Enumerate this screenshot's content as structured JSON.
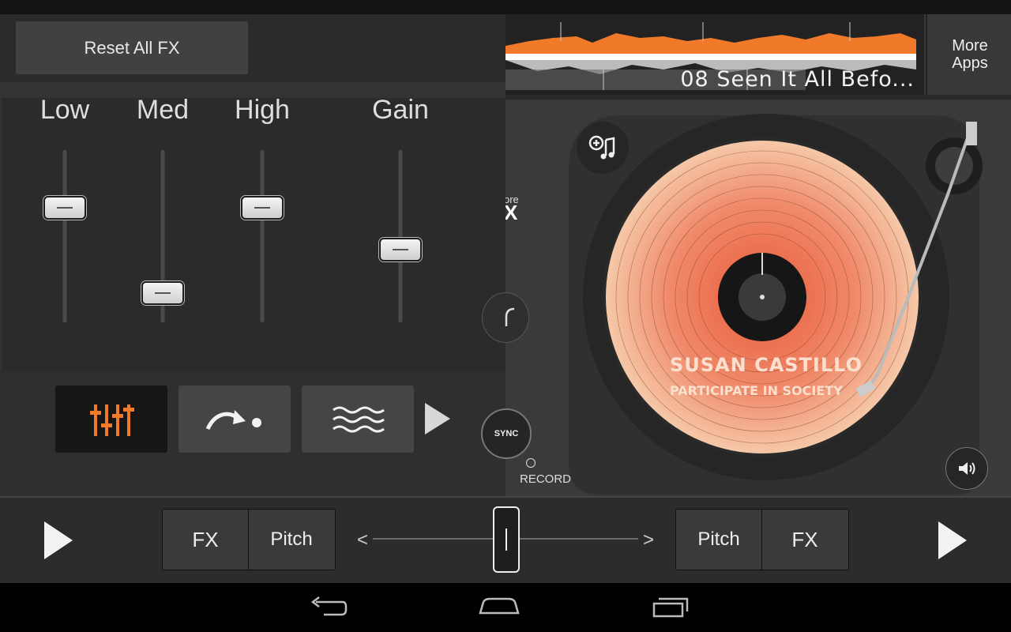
{
  "fx_panel": {
    "reset_label": "Reset All FX",
    "eq": [
      {
        "label": "Low",
        "level": 0.75
      },
      {
        "label": "Med",
        "level": 0.26
      },
      {
        "label": "High",
        "level": 0.75
      },
      {
        "label": "Gain",
        "level": 0.51
      }
    ],
    "fx_buttons": [
      {
        "icon": "eq-sliders-icon",
        "active": true
      },
      {
        "icon": "echo-arrow-icon",
        "active": false
      },
      {
        "icon": "wave-icon",
        "active": false
      }
    ],
    "next_icon": "play-next-icon"
  },
  "deck": {
    "track_title": "08 Seen It All Befo...",
    "more_apps_line1": "More",
    "more_apps_line2": "Apps",
    "more_fx_line1": "ore",
    "more_fx_line2": "X",
    "sync_label": "SYNC",
    "record_label": "RECORD",
    "vinyl_artist": "SUSAN CASTILLO",
    "vinyl_title": "PARTICIPATE IN SOCIETY",
    "accent_color": "#f07a2a"
  },
  "bottom_bar": {
    "left_fx": "FX",
    "left_pitch": "Pitch",
    "right_pitch": "Pitch",
    "right_fx": "FX",
    "chevron_left": "<",
    "chevron_right": ">",
    "crossfader_position": 0.5
  }
}
